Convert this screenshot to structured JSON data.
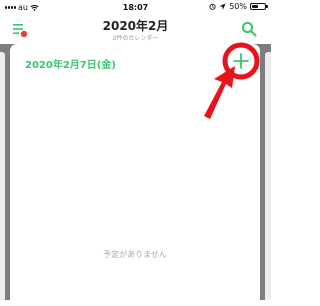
{
  "status_bar": {
    "carrier": "au",
    "time": "18:07",
    "battery_text": "50%",
    "battery_level": 0.5
  },
  "header": {
    "title": "2020年2月",
    "subtitle": "2件のカレンダー"
  },
  "day_card": {
    "date_label": "2020年2月7日(金)",
    "empty_text": "予定がありません"
  },
  "colors": {
    "accent_green": "#3cc46f",
    "annotation_red": "#e8121a",
    "menu_badge_red": "#e8403a"
  },
  "icons": [
    "menu-icon",
    "search-icon",
    "plus-icon",
    "signal-icon",
    "wifi-icon",
    "location-arrow-icon",
    "alarm-icon",
    "battery-icon"
  ]
}
